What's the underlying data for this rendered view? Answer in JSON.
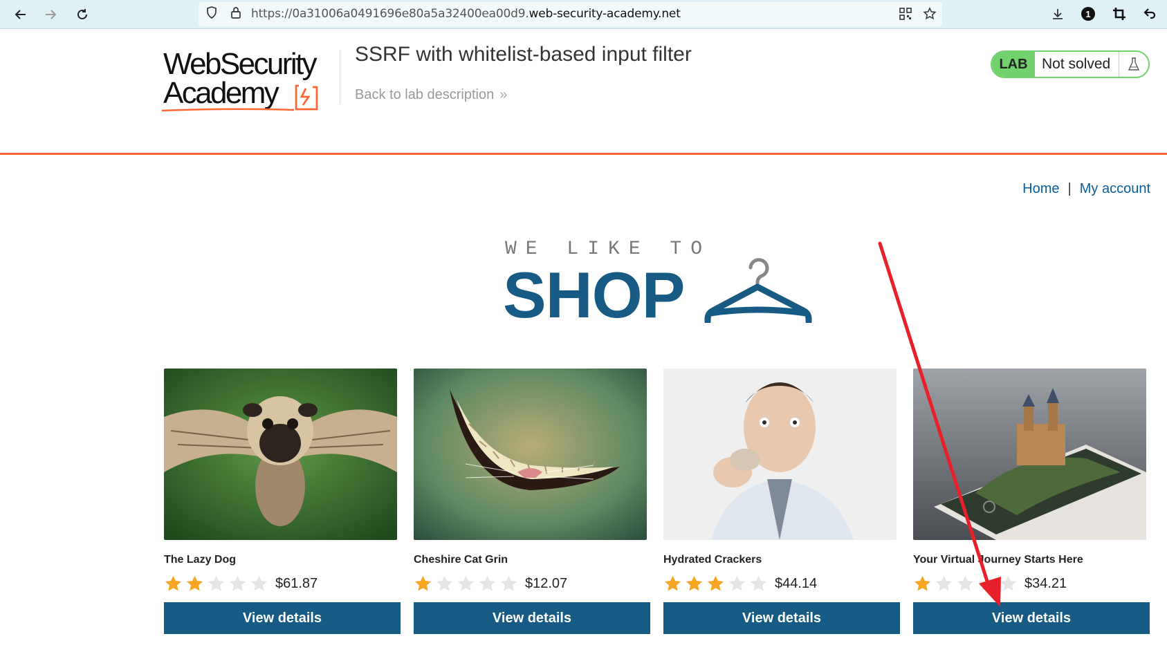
{
  "browser": {
    "url_prefix": "https://0a31006a0491696e80a5a32400ea00d9.",
    "url_host": "web-security-academy.net",
    "profile_badge": "1"
  },
  "lab": {
    "logo_line1": "WebSecurity",
    "logo_line2": "Academy",
    "title": "SSRF with whitelist-based input filter",
    "back_link": "Back to lab description",
    "badge": "LAB",
    "status": "Not solved"
  },
  "nav": {
    "home": "Home",
    "separator": "|",
    "my_account": "My account"
  },
  "banner": {
    "tagline": "WE LIKE TO",
    "headline": "SHOP"
  },
  "products": [
    {
      "name": "The Lazy Dog",
      "rating": 2,
      "max_rating": 5,
      "price": "$61.87",
      "button": "View details"
    },
    {
      "name": "Cheshire Cat Grin",
      "rating": 1,
      "max_rating": 5,
      "price": "$12.07",
      "button": "View details"
    },
    {
      "name": "Hydrated Crackers",
      "rating": 3,
      "max_rating": 5,
      "price": "$44.14",
      "button": "View details"
    },
    {
      "name": "Your Virtual Journey Starts Here",
      "rating": 1,
      "max_rating": 5,
      "price": "$34.21",
      "button": "View details"
    }
  ],
  "colors": {
    "brand_blue": "#175a84",
    "accent_orange": "#ff6633",
    "lab_green": "#70d16d",
    "link_blue": "#0a5e9c",
    "star_gold": "#f5a623",
    "annotation_red": "#e8202a"
  }
}
